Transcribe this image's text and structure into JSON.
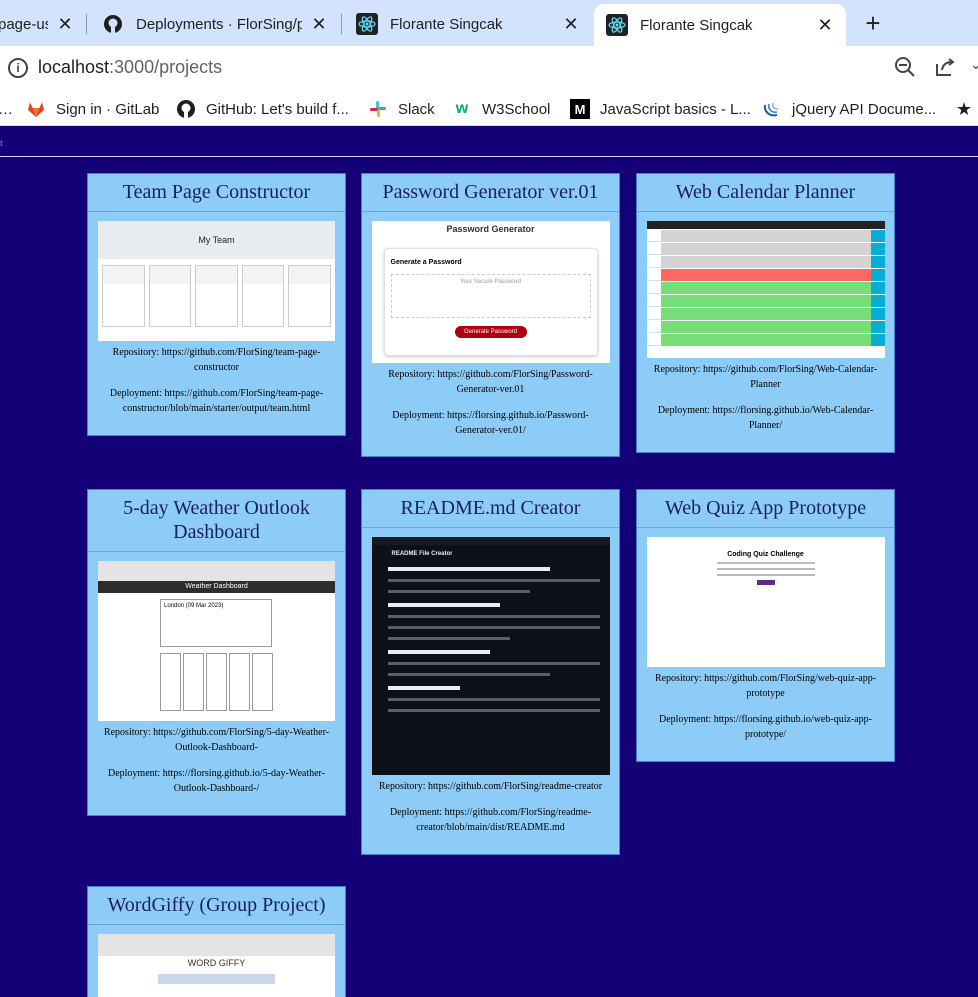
{
  "browser": {
    "tabs": [
      {
        "label": "page-us",
        "icon": "page-icon"
      },
      {
        "label": "Deployments · FlorSing/pc",
        "icon": "github-icon"
      },
      {
        "label": "Florante Singcak",
        "icon": "react-icon"
      },
      {
        "label": "Florante Singcak",
        "icon": "react-icon"
      }
    ],
    "url_host": "localhost",
    "url_rest": ":3000/projects",
    "bookmarks": [
      {
        "label": "Sign in · GitLab",
        "icon": "gitlab-icon"
      },
      {
        "label": "GitHub: Let's build f...",
        "icon": "github-icon"
      },
      {
        "label": "Slack",
        "icon": "slack-icon"
      },
      {
        "label": "W3School",
        "icon": "w3school-icon"
      },
      {
        "label": "JavaScript basics - L...",
        "icon": "mdn-icon"
      },
      {
        "label": "jQuery API Docume...",
        "icon": "jquery-icon"
      }
    ]
  },
  "page": {
    "top_link": "t",
    "projects": [
      {
        "title": "Team Page Constructor",
        "repo": "Repository: https://github.com/FlorSing/team-page-constructor",
        "deploy": "Deployment: https://github.com/FlorSing/team-page-constructor/blob/main/starter/output/team.html",
        "thumb_title": "My Team"
      },
      {
        "title": "Password Generator ver.01",
        "repo": "Repository: https://github.com/FlorSing/Password-Generator-ver.01",
        "deploy": "Deployment: https://florsing.github.io/Password-Generator-ver.01/",
        "thumb_title": "Password Generator",
        "thumb_sub": "Generate a Password",
        "thumb_placeholder": "Your Secure Password",
        "thumb_button": "Generate Password"
      },
      {
        "title": "Web Calendar Planner",
        "repo": "Repository: https://github.com/FlorSing/Web-Calendar-Planner",
        "deploy": "Deployment: https://florsing.github.io/Web-Calendar-Planner/"
      },
      {
        "title": "5-day Weather Outlook Dashboard",
        "repo": "Repository: https://github.com/FlorSing/5-day-Weather-Outlook-Dashboard-",
        "deploy": "Deployment: https://florsing.github.io/5-day-Weather-Outlook-Dashboard-/",
        "thumb_title": "Weather Dashboard",
        "thumb_city": "London (09 Mar 2023)"
      },
      {
        "title": "README.md Creator",
        "repo": "Repository: https://github.com/FlorSing/readme-creator",
        "deploy": "Deployment: https://github.com/FlorSing/readme-creator/blob/main/dist/README.md",
        "thumb_title": "README File Creator"
      },
      {
        "title": "Web Quiz App Prototype",
        "repo": "Repository: https://github.com/FlorSing/web-quiz-app-prototype",
        "deploy": "Deployment: https://florsing.github.io/web-quiz-app-prototype/",
        "thumb_title": "Coding Quiz Challenge"
      },
      {
        "title": "WordGiffy (Group Project)",
        "thumb_title": "WORD GIFFY"
      }
    ]
  },
  "colors": {
    "page_bg": "#140077",
    "card_bg": "#8dccf7",
    "card_title": "#1b1f5c"
  }
}
